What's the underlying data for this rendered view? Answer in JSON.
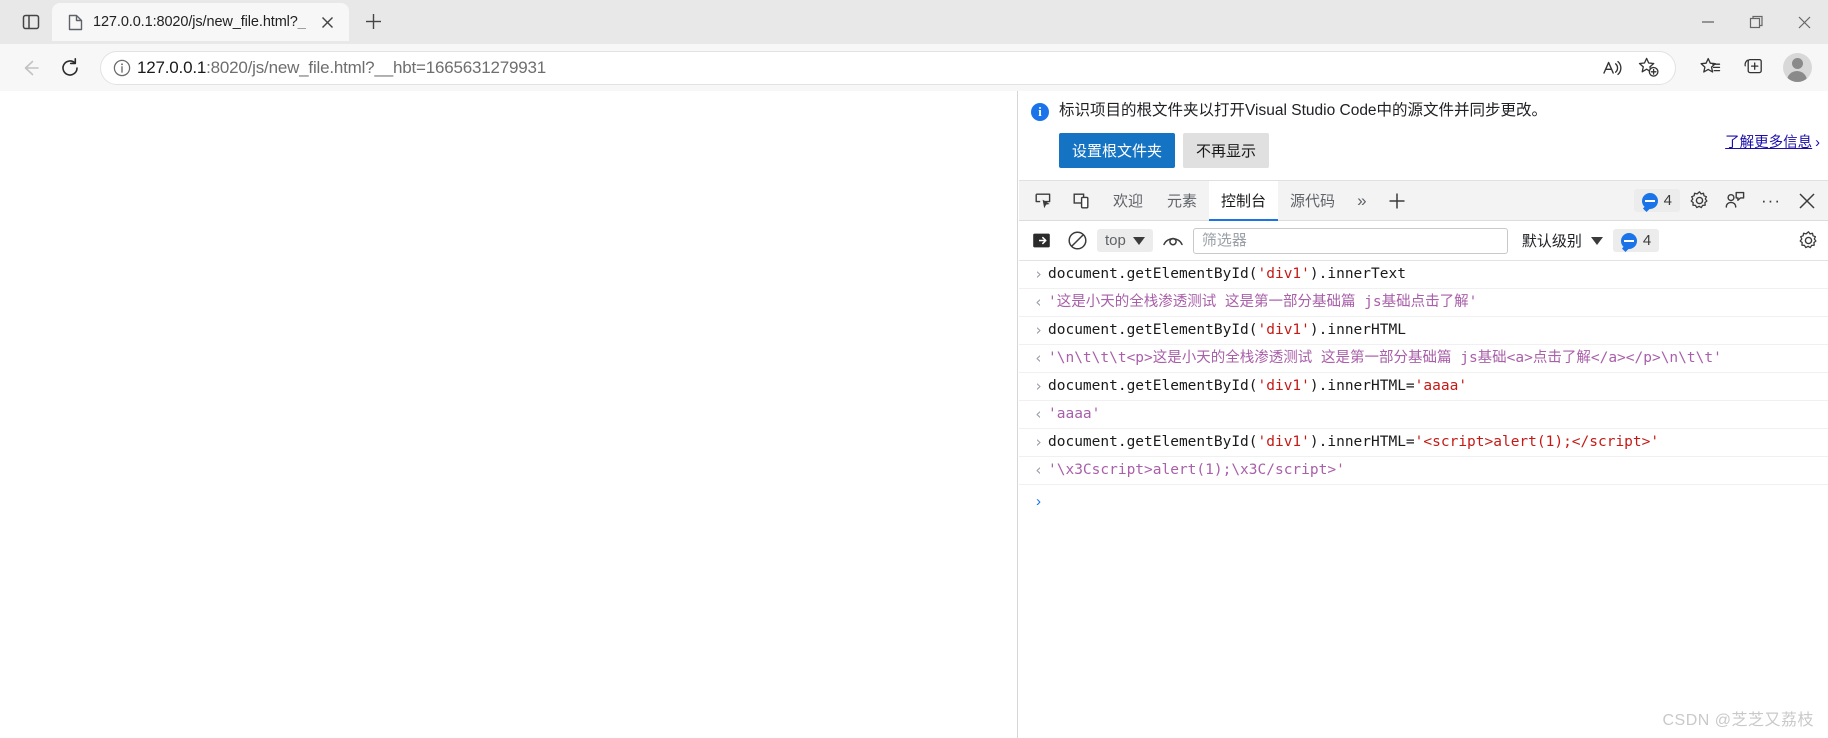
{
  "window": {
    "minimize_label": "最小化",
    "restore_label": "还原",
    "close_label": "关闭"
  },
  "tabstrip": {
    "tab_search_label": "标签页搜索",
    "tabs": [
      {
        "title": "127.0.0.1:8020/js/new_file.html?",
        "title_suffix": "_",
        "favicon": "page-icon"
      }
    ],
    "new_tab_label": "新建标签页",
    "close_tab_label": "关闭标签页"
  },
  "navbar": {
    "back_label": "返回",
    "reload_label": "刷新",
    "info_icon": "info-icon",
    "url_scheme_host": "127.0.0.1",
    "url_rest": ":8020/js/new_file.html?__hbt=1665631279931",
    "url_full": "127.0.0.1:8020/js/new_file.html?__hbt=1665631279931",
    "read_aloud_label": "朗读此页面",
    "add_favorite_label": "添加到收藏夹",
    "favorites_label": "收藏夹",
    "collections_label": "集锦",
    "profile_label": "个人资料"
  },
  "infobar": {
    "icon": "info-circle-icon",
    "message": "标识项目的根文件夹以打开Visual Studio Code中的源文件并同步更改。",
    "learn_more": "了解更多信息",
    "learn_more_chevron": "›",
    "primary_button": "设置根文件夹",
    "secondary_button": "不再显示"
  },
  "devtools": {
    "inspect_label": "检查元素",
    "device_toolbar_label": "切换设备仿真",
    "tabs": [
      {
        "label": "欢迎",
        "active": false
      },
      {
        "label": "元素",
        "active": false
      },
      {
        "label": "控制台",
        "active": true
      },
      {
        "label": "源代码",
        "active": false
      }
    ],
    "more_tabs": "»",
    "add_tab": "+",
    "issues_count": "4",
    "settings_label": "设置",
    "feedback_label": "发送反馈",
    "more_options": "···",
    "close_label": "关闭 DevTools"
  },
  "console_toolbar": {
    "sidebar_toggle_label": "显示控制台侧边栏",
    "clear_label": "清除控制台",
    "context_value": "top",
    "eye_label": "创建实时表达式",
    "filter_placeholder": "筛选器",
    "filter_value": "",
    "level_value": "默认级别",
    "issues_count": "4",
    "settings_label": "控制台设置"
  },
  "console": {
    "prompt_in": "›",
    "prompt_out": "‹",
    "entries": [
      {
        "type": "input",
        "parts": [
          {
            "t": "document.getElementById(",
            "c": "plain"
          },
          {
            "t": "'div1'",
            "c": "string"
          },
          {
            "t": ").innerText",
            "c": "plain"
          }
        ]
      },
      {
        "type": "result",
        "text": "'这是小天的全栈渗透测试 这是第一部分基础篇 js基础点击了解'"
      },
      {
        "type": "input",
        "parts": [
          {
            "t": "document.getElementById(",
            "c": "plain"
          },
          {
            "t": "'div1'",
            "c": "string"
          },
          {
            "t": ").innerHTML",
            "c": "plain"
          }
        ]
      },
      {
        "type": "result",
        "text": "'\\n\\t\\t\\t<p>这是小天的全栈渗透测试 这是第一部分基础篇 js基础<a>点击了解</a></p>\\n\\t\\t'"
      },
      {
        "type": "input",
        "parts": [
          {
            "t": "document.getElementById(",
            "c": "plain"
          },
          {
            "t": "'div1'",
            "c": "string"
          },
          {
            "t": ").innerHTML=",
            "c": "plain"
          },
          {
            "t": "'aaaa'",
            "c": "string"
          }
        ]
      },
      {
        "type": "result",
        "text": "'aaaa'"
      },
      {
        "type": "input",
        "parts": [
          {
            "t": "document.getElementById(",
            "c": "plain"
          },
          {
            "t": "'div1'",
            "c": "string"
          },
          {
            "t": ").innerHTML=",
            "c": "plain"
          },
          {
            "t": "'<script>alert(1);</script>'",
            "c": "string"
          }
        ]
      },
      {
        "type": "result",
        "text": "'\\x3Cscript>alert(1);\\x3C/script>'"
      }
    ]
  },
  "watermark": "CSDN @芝芝又荔枝",
  "colors": {
    "accent": "#1a73e8",
    "primary_button": "#1573c4",
    "link": "#1a0dab",
    "string": "#c41a16",
    "result": "#a95fa9"
  }
}
